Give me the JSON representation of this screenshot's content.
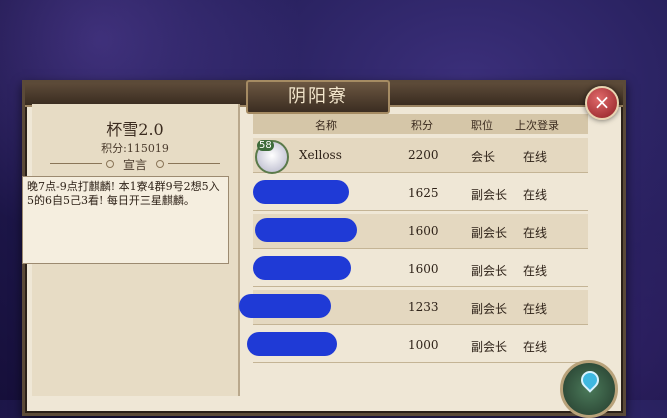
{
  "window": {
    "title": "阴阳寮",
    "close_label": "×"
  },
  "guild": {
    "name": "杯雪2.0",
    "score_text": "积分:115019",
    "declaration_label": "宣言",
    "declaration_text": "晚7点-9点打麒麟! 本1寮4群9号2想5入5的6自5己3看! 每日开三星麒麟。"
  },
  "table": {
    "headers": {
      "name": "名称",
      "score": "积分",
      "role": "职位",
      "last_login": "上次登录"
    },
    "rows": [
      {
        "level": "58",
        "name": "Xelloss",
        "score": "2200",
        "role": "会长",
        "last_login": "在线"
      },
      {
        "level": "",
        "name": "",
        "score": "1625",
        "role": "副会长",
        "last_login": "在线"
      },
      {
        "level": "",
        "name": "",
        "score": "1600",
        "role": "副会长",
        "last_login": "在线"
      },
      {
        "level": "",
        "name": "",
        "score": "1600",
        "role": "副会长",
        "last_login": "在线"
      },
      {
        "level": "",
        "name": "",
        "score": "1233",
        "role": "副会长",
        "last_login": "在线"
      },
      {
        "level": "",
        "name": "",
        "score": "1000",
        "role": "副会长",
        "last_login": "在线"
      }
    ]
  },
  "colors": {
    "panel": "#efe7d6",
    "frame": "#5b4a38",
    "redaction": "#1f3ad6",
    "close": "#b22e36"
  },
  "icons": {
    "close": "close-icon",
    "map": "map-pin-icon"
  }
}
